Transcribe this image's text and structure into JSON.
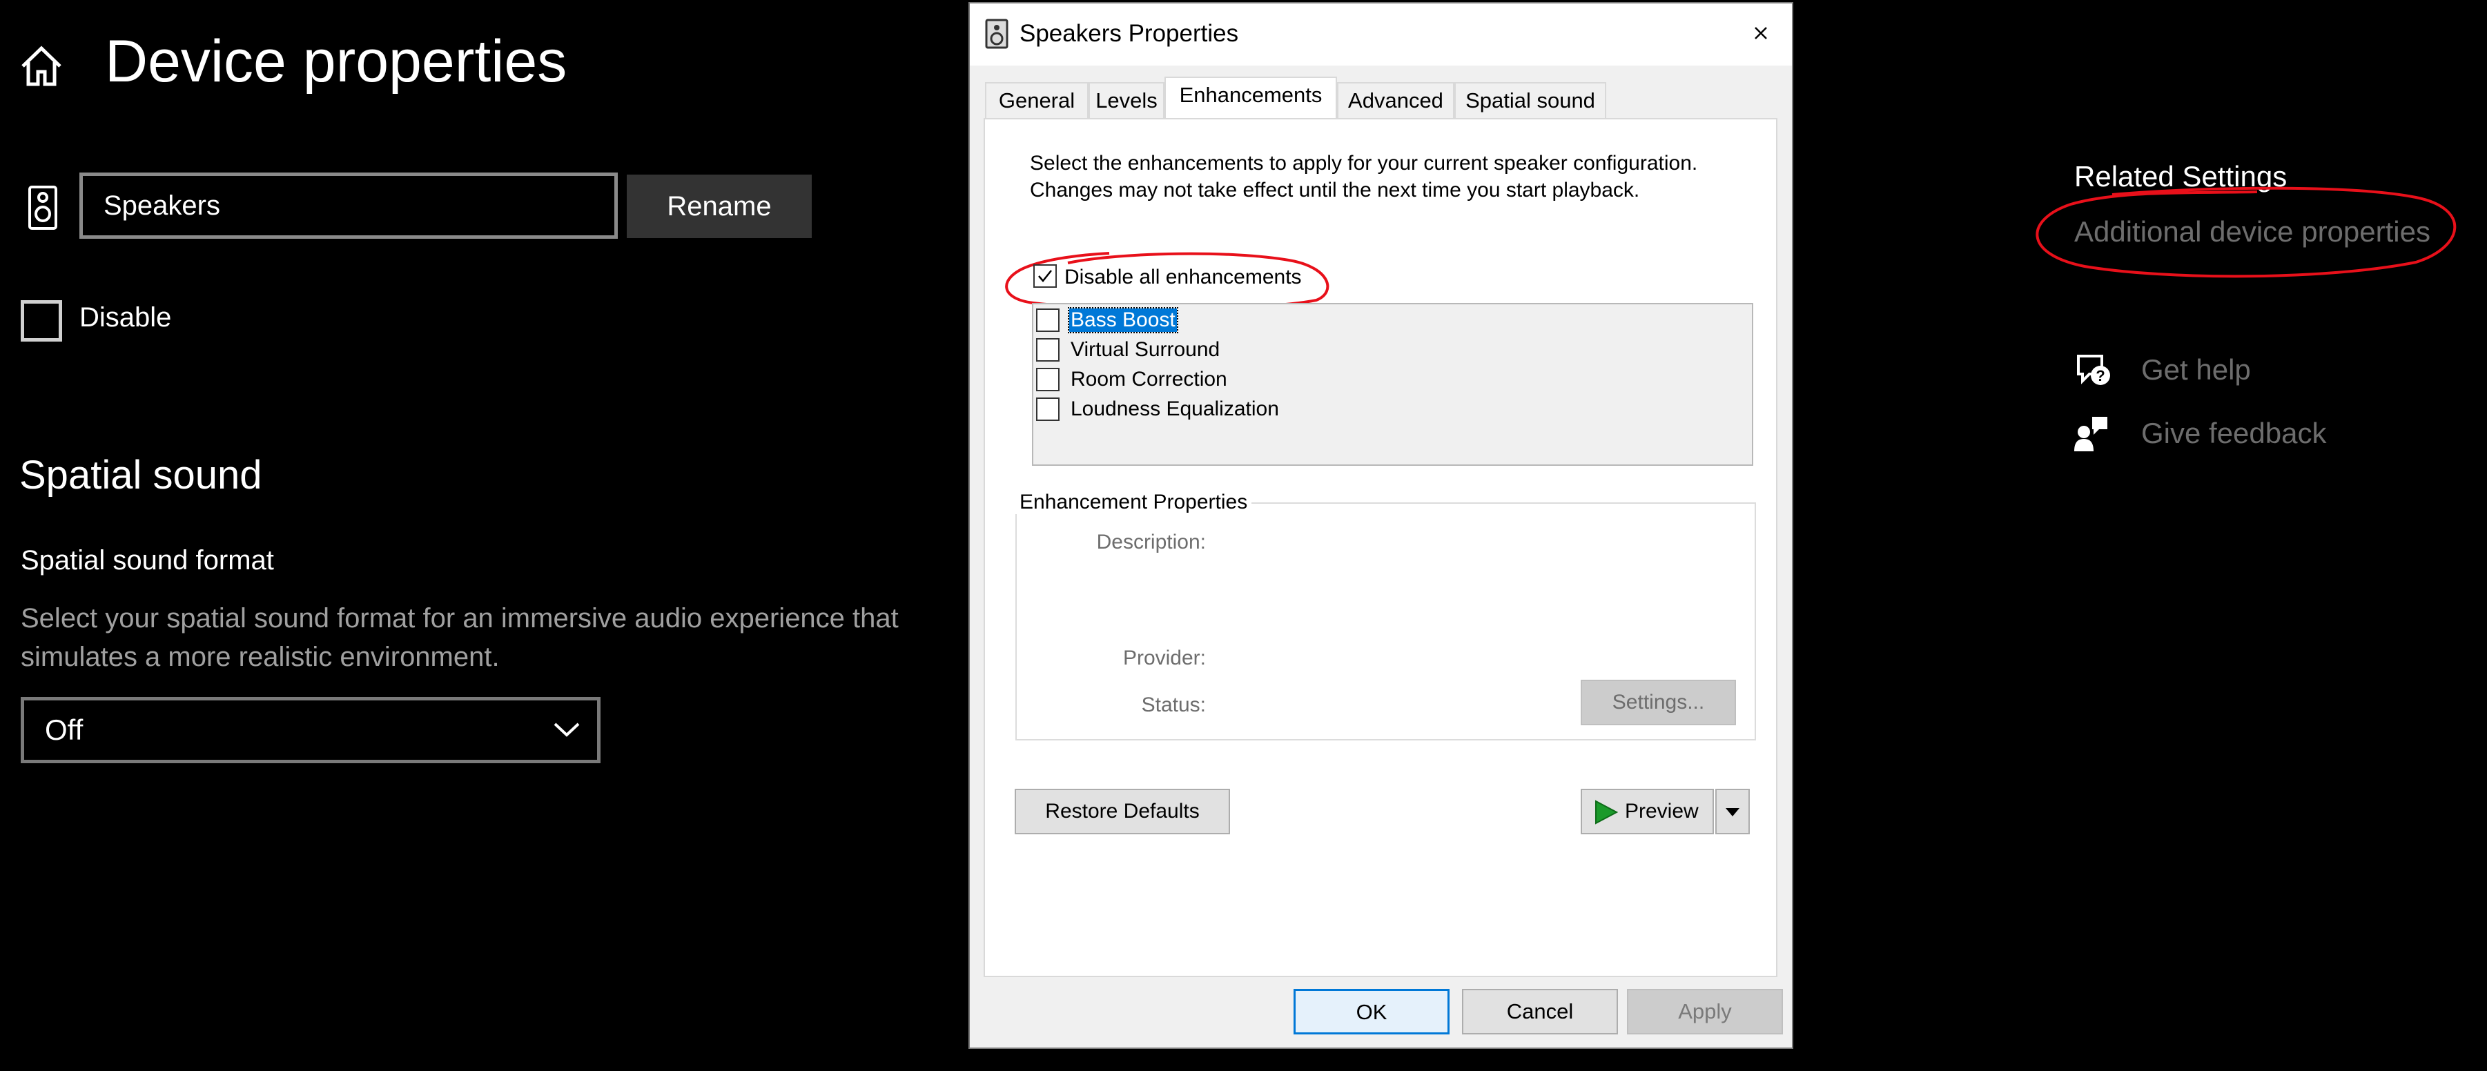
{
  "settings_page": {
    "title": "Device properties",
    "device_name_value": "Speakers",
    "rename_label": "Rename",
    "disable_label": "Disable",
    "section_title": "Spatial sound",
    "format_label": "Spatial sound format",
    "format_description": "Select your spatial sound format for an immersive audio experience that simulates a more realistic environment.",
    "format_selected": "Off"
  },
  "related": {
    "title": "Related Settings",
    "additional_link": "Additional device properties",
    "get_help": "Get help",
    "give_feedback": "Give feedback"
  },
  "dialog": {
    "title": "Speakers Properties",
    "tabs": [
      "General",
      "Levels",
      "Enhancements",
      "Advanced",
      "Spatial sound"
    ],
    "active_tab": "Enhancements",
    "intro": "Select the enhancements to apply for your current speaker configuration. Changes may not take effect until the next time you start playback.",
    "disable_all_label": "Disable all enhancements",
    "disable_all_checked": true,
    "enhancements": [
      {
        "label": "Bass Boost",
        "checked": false,
        "selected": true
      },
      {
        "label": "Virtual Surround",
        "checked": false,
        "selected": false
      },
      {
        "label": "Room Correction",
        "checked": false,
        "selected": false
      },
      {
        "label": "Loudness Equalization",
        "checked": false,
        "selected": false
      }
    ],
    "properties_group": "Enhancement Properties",
    "description_label": "Description:",
    "provider_label": "Provider:",
    "status_label": "Status:",
    "settings_button": "Settings...",
    "restore_defaults": "Restore Defaults",
    "preview": "Preview",
    "ok": "OK",
    "cancel": "Cancel",
    "apply": "Apply"
  },
  "colors": {
    "background": "#000000",
    "muted_text": "#6d6d6d",
    "annotation_red": "#e8101a",
    "selection": "#0078d7"
  }
}
